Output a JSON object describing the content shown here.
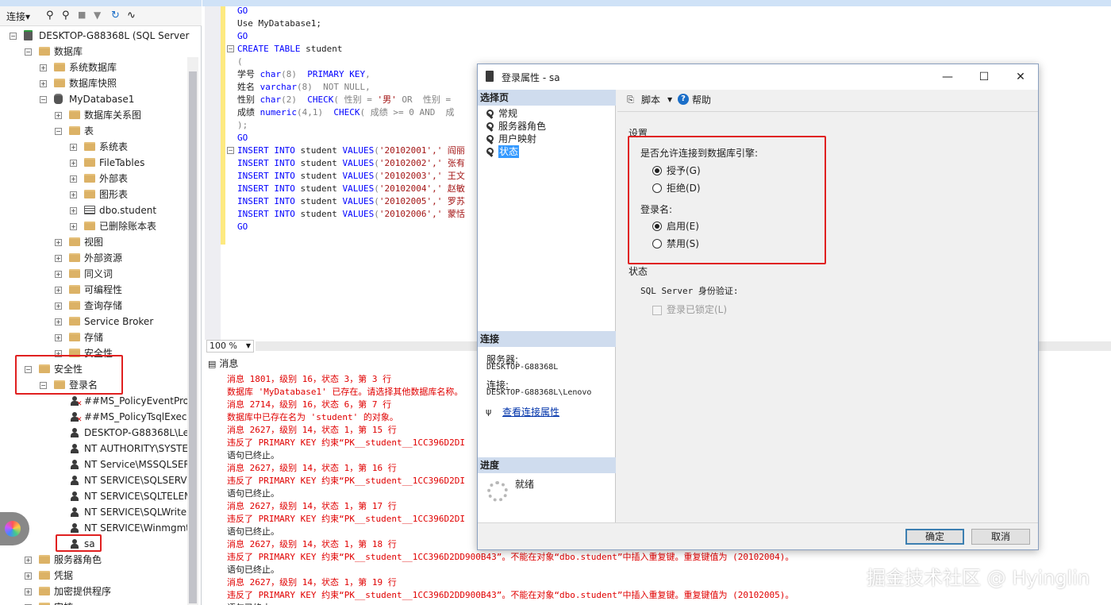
{
  "object_explorer": {
    "toolbar": {
      "connect": "连接▾"
    },
    "tree": [
      {
        "indent": 0,
        "toggle": "−",
        "icon": "server",
        "label": "DESKTOP-G88368L (SQL Server"
      },
      {
        "indent": 1,
        "toggle": "−",
        "icon": "folder",
        "label": "数据库"
      },
      {
        "indent": 2,
        "toggle": "+",
        "icon": "folder",
        "label": "系统数据库"
      },
      {
        "indent": 2,
        "toggle": "+",
        "icon": "folder",
        "label": "数据库快照"
      },
      {
        "indent": 2,
        "toggle": "−",
        "icon": "db",
        "label": "MyDatabase1"
      },
      {
        "indent": 3,
        "toggle": "+",
        "icon": "folder",
        "label": "数据库关系图"
      },
      {
        "indent": 3,
        "toggle": "−",
        "icon": "folder",
        "label": "表"
      },
      {
        "indent": 4,
        "toggle": "+",
        "icon": "folder",
        "label": "系统表"
      },
      {
        "indent": 4,
        "toggle": "+",
        "icon": "folder",
        "label": "FileTables"
      },
      {
        "indent": 4,
        "toggle": "+",
        "icon": "folder",
        "label": "外部表"
      },
      {
        "indent": 4,
        "toggle": "+",
        "icon": "folder",
        "label": "图形表"
      },
      {
        "indent": 4,
        "toggle": "+",
        "icon": "table",
        "label": "dbo.student"
      },
      {
        "indent": 4,
        "toggle": "+",
        "icon": "folder",
        "label": "已删除账本表"
      },
      {
        "indent": 3,
        "toggle": "+",
        "icon": "folder",
        "label": "视图"
      },
      {
        "indent": 3,
        "toggle": "+",
        "icon": "folder",
        "label": "外部资源"
      },
      {
        "indent": 3,
        "toggle": "+",
        "icon": "folder",
        "label": "同义词"
      },
      {
        "indent": 3,
        "toggle": "+",
        "icon": "folder",
        "label": "可编程性"
      },
      {
        "indent": 3,
        "toggle": "+",
        "icon": "folder",
        "label": "查询存储"
      },
      {
        "indent": 3,
        "toggle": "+",
        "icon": "folder",
        "label": "Service Broker"
      },
      {
        "indent": 3,
        "toggle": "+",
        "icon": "folder",
        "label": "存储"
      },
      {
        "indent": 3,
        "toggle": "+",
        "icon": "folder",
        "label": "安全性"
      },
      {
        "indent": 1,
        "toggle": "−",
        "icon": "folder",
        "label": "安全性"
      },
      {
        "indent": 2,
        "toggle": "−",
        "icon": "folder",
        "label": "登录名"
      },
      {
        "indent": 3,
        "toggle": "",
        "icon": "userx",
        "label": "##MS_PolicyEventProc"
      },
      {
        "indent": 3,
        "toggle": "",
        "icon": "userx",
        "label": "##MS_PolicyTsqlExecu"
      },
      {
        "indent": 3,
        "toggle": "",
        "icon": "user",
        "label": "DESKTOP-G88368L\\Le"
      },
      {
        "indent": 3,
        "toggle": "",
        "icon": "user",
        "label": "NT AUTHORITY\\SYSTE"
      },
      {
        "indent": 3,
        "toggle": "",
        "icon": "user",
        "label": "NT Service\\MSSQLSER"
      },
      {
        "indent": 3,
        "toggle": "",
        "icon": "user",
        "label": "NT SERVICE\\SQLSERVI"
      },
      {
        "indent": 3,
        "toggle": "",
        "icon": "user",
        "label": "NT SERVICE\\SQLTELEM"
      },
      {
        "indent": 3,
        "toggle": "",
        "icon": "user",
        "label": "NT SERVICE\\SQLWrite"
      },
      {
        "indent": 3,
        "toggle": "",
        "icon": "user",
        "label": "NT SERVICE\\Winmgmt"
      },
      {
        "indent": 3,
        "toggle": "",
        "icon": "user",
        "label": "sa"
      },
      {
        "indent": 1,
        "toggle": "+",
        "icon": "folder",
        "label": "服务器角色"
      },
      {
        "indent": 1,
        "toggle": "+",
        "icon": "folder",
        "label": "凭据"
      },
      {
        "indent": 1,
        "toggle": "+",
        "icon": "folder",
        "label": "加密提供程序"
      },
      {
        "indent": 1,
        "toggle": "+",
        "icon": "folder",
        "label": "审核"
      }
    ]
  },
  "editor": {
    "lines": [
      [
        [
          "GO",
          "kw"
        ]
      ],
      [
        [
          "Use MyDatabase1;",
          "blk"
        ]
      ],
      [
        [
          "GO",
          "kw"
        ]
      ],
      [
        [
          "CREATE TABLE ",
          "kw"
        ],
        [
          "student",
          "blk"
        ]
      ],
      [
        [
          "(",
          "gy"
        ]
      ],
      [
        [
          "学号 ",
          "blk"
        ],
        [
          "char",
          "ty"
        ],
        [
          "(8)  ",
          "gy"
        ],
        [
          "PRIMARY KEY",
          "kw"
        ],
        [
          ",",
          "gy"
        ]
      ],
      [
        [
          "姓名 ",
          "blk"
        ],
        [
          "varchar",
          "ty"
        ],
        [
          "(8)  ",
          "gy"
        ],
        [
          "NOT NULL",
          "gy"
        ],
        [
          ",",
          "gy"
        ]
      ],
      [
        [
          "性别 ",
          "blk"
        ],
        [
          "char",
          "ty"
        ],
        [
          "(2)  ",
          "gy"
        ],
        [
          "CHECK",
          "kw"
        ],
        [
          "( 性别 = ",
          "gy"
        ],
        [
          "'男'",
          "st"
        ],
        [
          " OR  性别 =",
          "gy"
        ]
      ],
      [
        [
          "成绩 ",
          "blk"
        ],
        [
          "numeric",
          "ty"
        ],
        [
          "(4,1)  ",
          "gy"
        ],
        [
          "CHECK",
          "kw"
        ],
        [
          "( 成绩 >= 0 AND  成",
          "gy"
        ]
      ],
      [
        [
          ");",
          "gy"
        ]
      ],
      [
        [
          "GO",
          "kw"
        ]
      ],
      [
        [
          "INSERT INTO ",
          "kw"
        ],
        [
          "student ",
          "blk"
        ],
        [
          "VALUES",
          "kw"
        ],
        [
          "(",
          "gy"
        ],
        [
          "'20102001',' 阎丽",
          "st"
        ]
      ],
      [
        [
          "INSERT INTO ",
          "kw"
        ],
        [
          "student ",
          "blk"
        ],
        [
          "VALUES",
          "kw"
        ],
        [
          "(",
          "gy"
        ],
        [
          "'20102002',' 张有",
          "st"
        ]
      ],
      [
        [
          "INSERT INTO ",
          "kw"
        ],
        [
          "student ",
          "blk"
        ],
        [
          "VALUES",
          "kw"
        ],
        [
          "(",
          "gy"
        ],
        [
          "'20102003',' 王文",
          "st"
        ]
      ],
      [
        [
          "INSERT INTO ",
          "kw"
        ],
        [
          "student ",
          "blk"
        ],
        [
          "VALUES",
          "kw"
        ],
        [
          "(",
          "gy"
        ],
        [
          "'20102004',' 赵敏",
          "st"
        ]
      ],
      [
        [
          "INSERT INTO ",
          "kw"
        ],
        [
          "student ",
          "blk"
        ],
        [
          "VALUES",
          "kw"
        ],
        [
          "(",
          "gy"
        ],
        [
          "'20102005',' 罗苏",
          "st"
        ]
      ],
      [
        [
          "INSERT INTO ",
          "kw"
        ],
        [
          "student ",
          "blk"
        ],
        [
          "VALUES",
          "kw"
        ],
        [
          "(",
          "gy"
        ],
        [
          "'20102006',' 蒙恬",
          "st"
        ]
      ],
      [
        [
          "GO",
          "kw"
        ]
      ]
    ],
    "zoom": "100 %"
  },
  "messages": {
    "tab_label": "消息",
    "lines": [
      [
        "消息 1801，级别 16，状态 3，第 3 行",
        "red"
      ],
      [
        "数据库 'MyDatabase1' 已存在。请选择其他数据库名称。",
        "red"
      ],
      [
        "消息 2714，级别 16，状态 6，第 7 行",
        "red"
      ],
      [
        "数据库中已存在名为 'student' 的对象。",
        "red"
      ],
      [
        "消息 2627，级别 14，状态 1，第 15 行",
        "red"
      ],
      [
        "违反了 PRIMARY KEY 约束“PK__student__1CC396D2DI",
        "red"
      ],
      [
        "语句已终止。",
        "blk"
      ],
      [
        "消息 2627，级别 14，状态 1，第 16 行",
        "red"
      ],
      [
        "违反了 PRIMARY KEY 约束“PK__student__1CC396D2DI",
        "red"
      ],
      [
        "语句已终止。",
        "blk"
      ],
      [
        "消息 2627，级别 14，状态 1，第 17 行",
        "red"
      ],
      [
        "违反了 PRIMARY KEY 约束“PK__student__1CC396D2DI",
        "red"
      ],
      [
        "语句已终止。",
        "blk"
      ],
      [
        "消息 2627，级别 14，状态 1，第 18 行",
        "red"
      ],
      [
        "违反了 PRIMARY KEY 约束“PK__student__1CC396D2DD900B43”。不能在对象“dbo.student”中插入重复键。重复键值为 (20102004)。",
        "red"
      ],
      [
        "语句已终止。",
        "blk"
      ],
      [
        "消息 2627，级别 14，状态 1，第 19 行",
        "red"
      ],
      [
        "违反了 PRIMARY KEY 约束“PK__student__1CC396D2DD900B43”。不能在对象“dbo.student”中插入重复键。重复键值为 (20102005)。",
        "red"
      ],
      [
        "语句已终止。",
        "blk"
      ]
    ]
  },
  "dialog": {
    "title": "登录属性 - sa",
    "select_page": "选择页",
    "pages": [
      "常规",
      "服务器角色",
      "用户映射",
      "状态"
    ],
    "selected_page": "状态",
    "connection_header": "连接",
    "server_label": "服务器:",
    "server_value": "DESKTOP-G88368L",
    "conn_label": "连接:",
    "conn_value": "DESKTOP-G88368L\\Lenovo",
    "view_conn_link": "查看连接属性",
    "progress_header": "进度",
    "progress_status": "就绪",
    "toolbar": {
      "script": "脚本",
      "help": "帮助"
    },
    "settings_label": "设置",
    "permit_question": "是否允许连接到数据库引擎:",
    "grant": "授予(G)",
    "deny": "拒绝(D)",
    "login_label": "登录名:",
    "enabled": "启用(E)",
    "disabled": "禁用(S)",
    "status_label": "状态",
    "sql_auth": "SQL Server 身份验证:",
    "locked_out": "登录已锁定(L)",
    "ok": "确定",
    "cancel": "取消",
    "accent": "#e02020"
  },
  "watermark": "掘金技术社区 @ Hyinglin"
}
